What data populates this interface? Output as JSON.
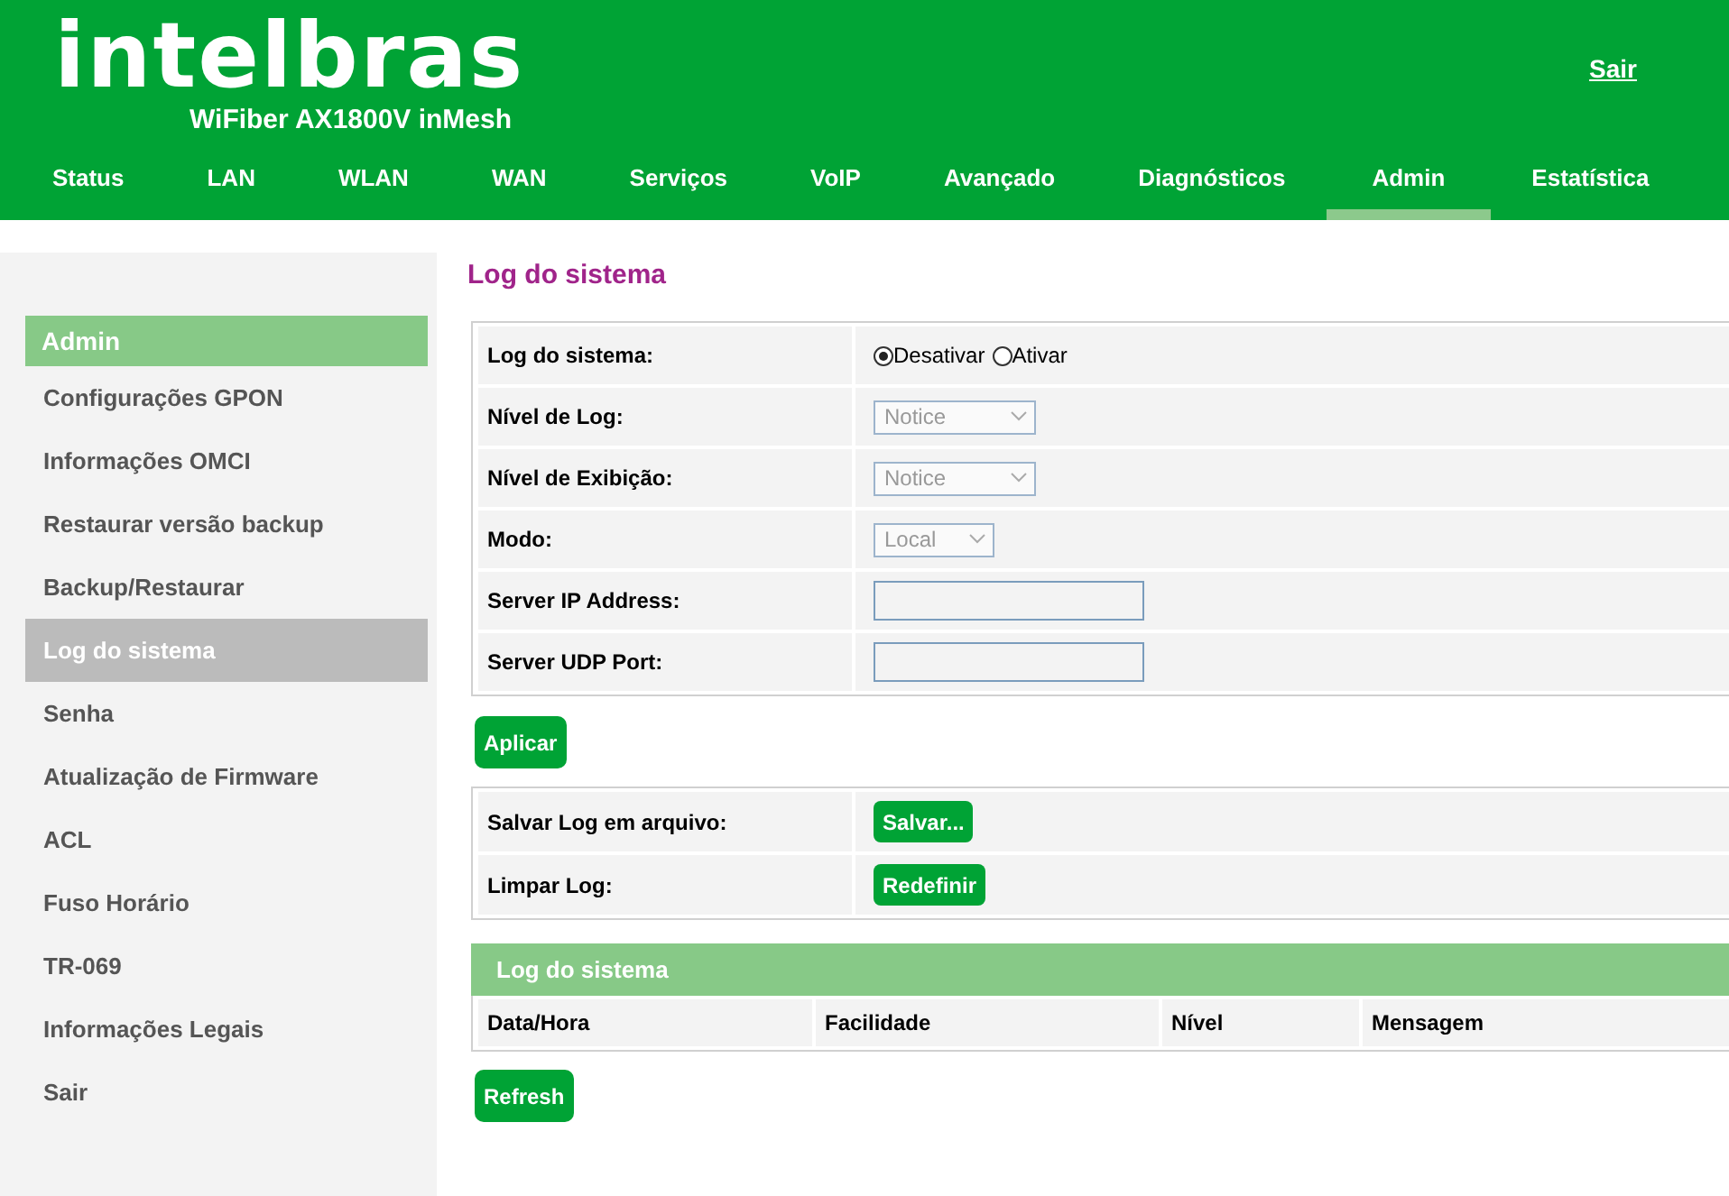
{
  "header": {
    "logo": "intelbras",
    "model": "WiFiber AX1800V inMesh",
    "logout": "Sair"
  },
  "nav": [
    {
      "label": "Status",
      "selected": false
    },
    {
      "label": "LAN",
      "selected": false
    },
    {
      "label": "WLAN",
      "selected": false
    },
    {
      "label": "WAN",
      "selected": false
    },
    {
      "label": "Serviços",
      "selected": false
    },
    {
      "label": "VoIP",
      "selected": false
    },
    {
      "label": "Avançado",
      "selected": false
    },
    {
      "label": "Diagnósticos",
      "selected": false
    },
    {
      "label": "Admin",
      "selected": true
    },
    {
      "label": "Estatística",
      "selected": false
    }
  ],
  "sidebar": {
    "title": "Admin",
    "items": [
      {
        "label": "Configurações GPON",
        "selected": false
      },
      {
        "label": "Informações OMCI",
        "selected": false
      },
      {
        "label": "Restaurar versão backup",
        "selected": false
      },
      {
        "label": "Backup/Restaurar",
        "selected": false
      },
      {
        "label": "Log do sistema",
        "selected": true
      },
      {
        "label": "Senha",
        "selected": false
      },
      {
        "label": "Atualização de Firmware",
        "selected": false
      },
      {
        "label": "ACL",
        "selected": false
      },
      {
        "label": "Fuso Horário",
        "selected": false
      },
      {
        "label": "TR-069",
        "selected": false
      },
      {
        "label": "Informações Legais",
        "selected": false
      },
      {
        "label": "Sair",
        "selected": false
      }
    ]
  },
  "page_title": "Log do sistema",
  "settings": [
    {
      "label": "Log do sistema:",
      "kind": "radio",
      "options": [
        {
          "label": "Desativar",
          "selected": true
        },
        {
          "label": "Ativar",
          "selected": false
        }
      ]
    },
    {
      "label": "Nível de Log:",
      "kind": "select",
      "value": "Notice",
      "disabled": true
    },
    {
      "label": "Nível de Exibição:",
      "kind": "select",
      "value": "Notice",
      "disabled": true
    },
    {
      "label": "Modo:",
      "kind": "select_small",
      "value": "Local",
      "disabled": true
    },
    {
      "label": "Server IP Address:",
      "kind": "text"
    },
    {
      "label": "Server UDP Port:",
      "kind": "text"
    }
  ],
  "apply_button": "Aplicar",
  "actions": [
    {
      "label": "Salvar Log em arquivo:",
      "button": "Salvar..."
    },
    {
      "label": "Limpar Log:",
      "button": "Redefinir"
    }
  ],
  "log_table": {
    "title": "Log do sistema",
    "columns": [
      "Data/Hora",
      "Facilidade",
      "Nível",
      "Mensagem"
    ]
  },
  "refresh_button": "Refresh"
}
